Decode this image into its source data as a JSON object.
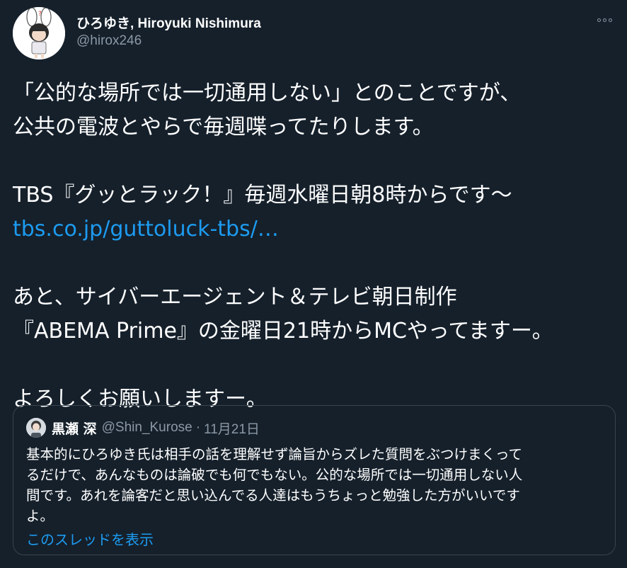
{
  "author": {
    "display_name": "ひろゆき, Hiroyuki Nishimura",
    "handle": "@hirox246",
    "avatar_icon": "avatar-icon"
  },
  "menu": {
    "icon": "more-options-icon"
  },
  "body": {
    "line1": "「公的な場所では一切通用しない」とのことですが、",
    "line2": "公共の電波とやらで毎週喋ってたりします。",
    "line3": "TBS『グッとラック！』毎週水曜日朝8時からです〜",
    "link": "tbs.co.jp/guttoluck-tbs/…",
    "line4": "あと、サイバーエージェント＆テレビ朝日制作",
    "line5": "『ABEMA Prime』の金曜日21時からMCやってますー。",
    "line6": "よろしくお願いしますー。"
  },
  "quote": {
    "name": "黒瀬 深",
    "handle": "@Shin_Kurose",
    "separator": "·",
    "date": "11月21日",
    "text_lines": [
      "基本的にひろゆき氏は相手の話を理解せず論旨からズレた質問をぶつけまくって",
      "るだけで、あんなものは論破でも何でもない。公的な場所では一切通用しない人",
      "間です。あれを論客だと思い込んでる人達はもうちょっと勉強した方がいいです",
      "よ。"
    ],
    "show_thread": "このスレッドを表示"
  },
  "colors": {
    "background": "#15202b",
    "text": "#ffffff",
    "secondary_text": "#8b98a5",
    "link": "#1d9bf0",
    "border": "#38444d"
  }
}
